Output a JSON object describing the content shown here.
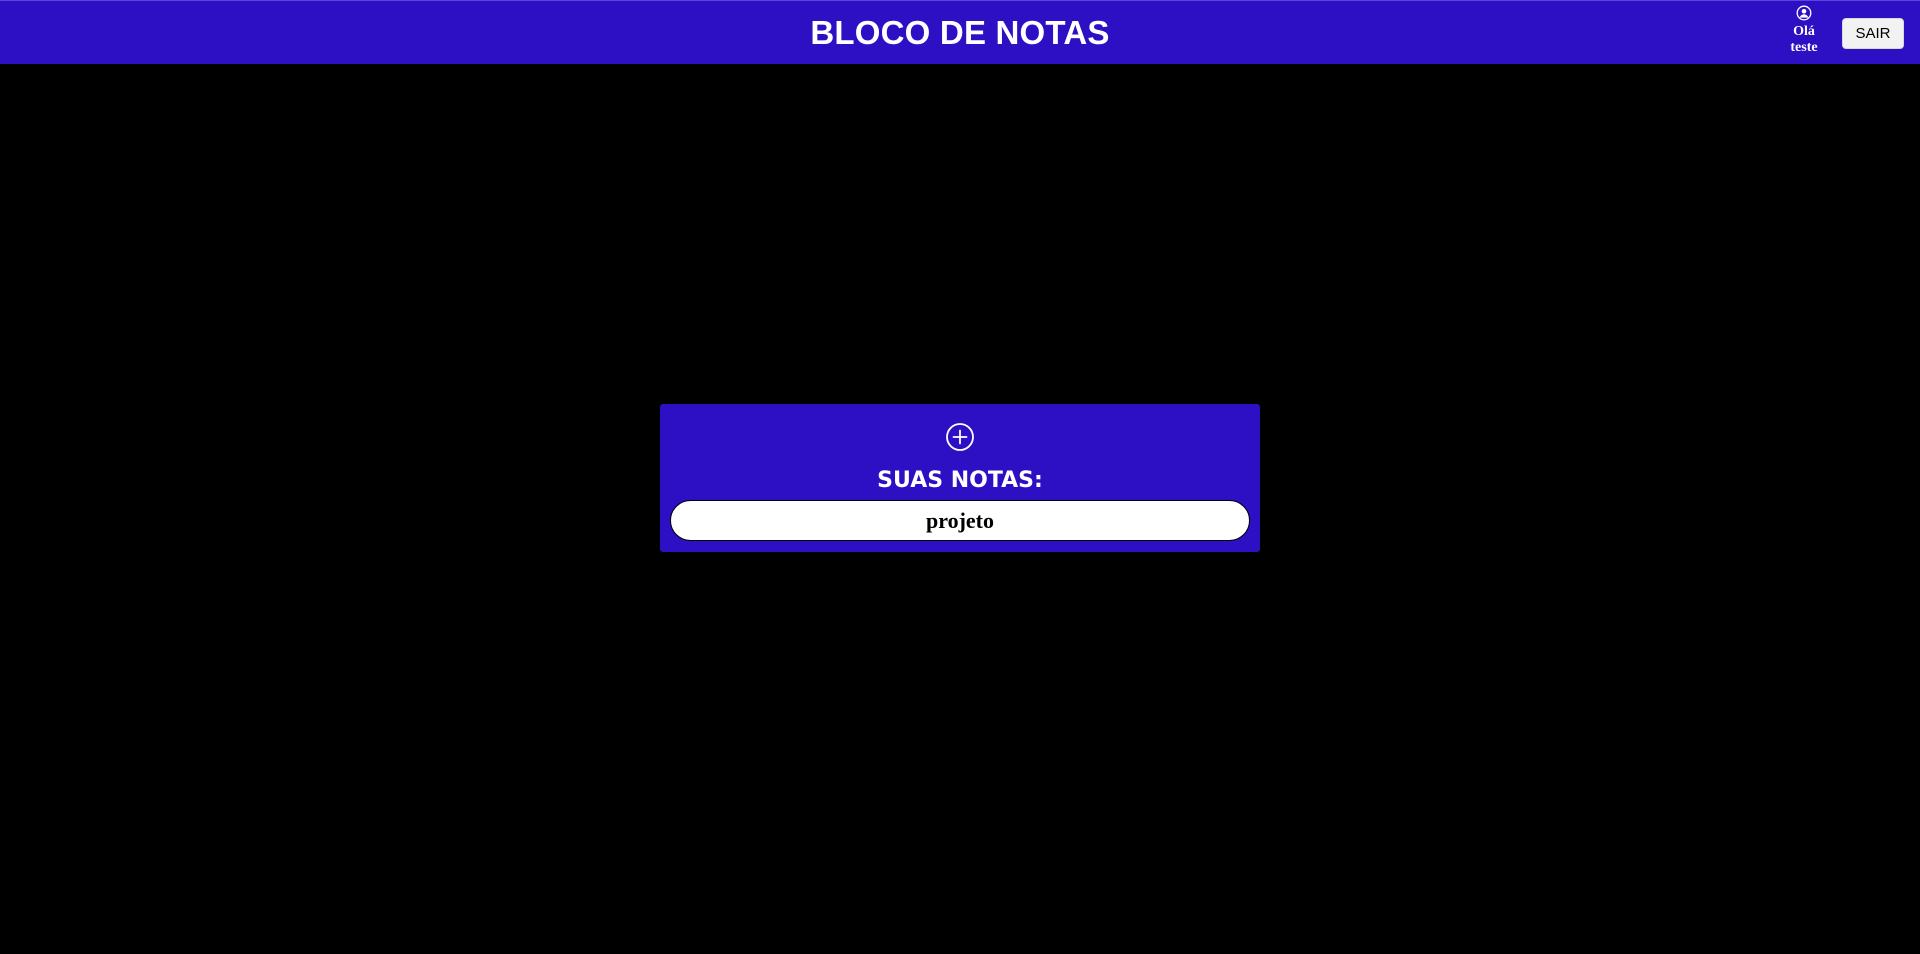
{
  "header": {
    "title": "BLOCO DE NOTAS",
    "user": {
      "icon": "user-circle-icon",
      "greeting": "Olá",
      "name": "teste"
    },
    "logout_label": "SAIR"
  },
  "notes_panel": {
    "add_icon": "plus-circle-icon",
    "heading": "SUAS NOTAS:",
    "notes": [
      {
        "title": "projeto"
      }
    ]
  },
  "colors": {
    "primary": "#2d0fc4",
    "background": "#000000",
    "note_background": "#ffffff",
    "text_light": "#ffffff"
  }
}
